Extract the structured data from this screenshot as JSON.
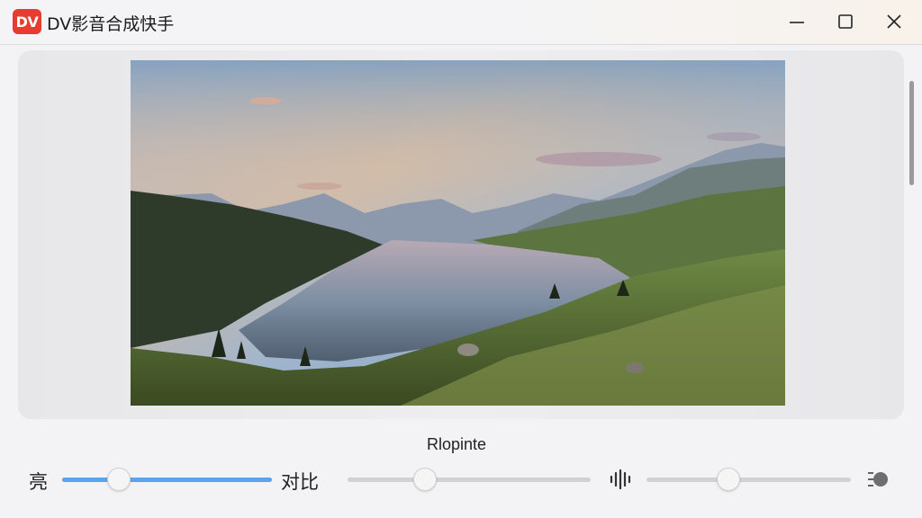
{
  "window": {
    "logo_text": "DV",
    "title": "DV影音合成快手",
    "accent_color": "#e63c31"
  },
  "preview": {
    "caption": "Rlopinte"
  },
  "controls": [
    {
      "label": "亮",
      "value": 0.27,
      "fill_color": "#5aa4ee"
    },
    {
      "label": "对比",
      "value": 0.32
    },
    {
      "icon": "audio-waveform-icon",
      "value": 0.4
    }
  ]
}
